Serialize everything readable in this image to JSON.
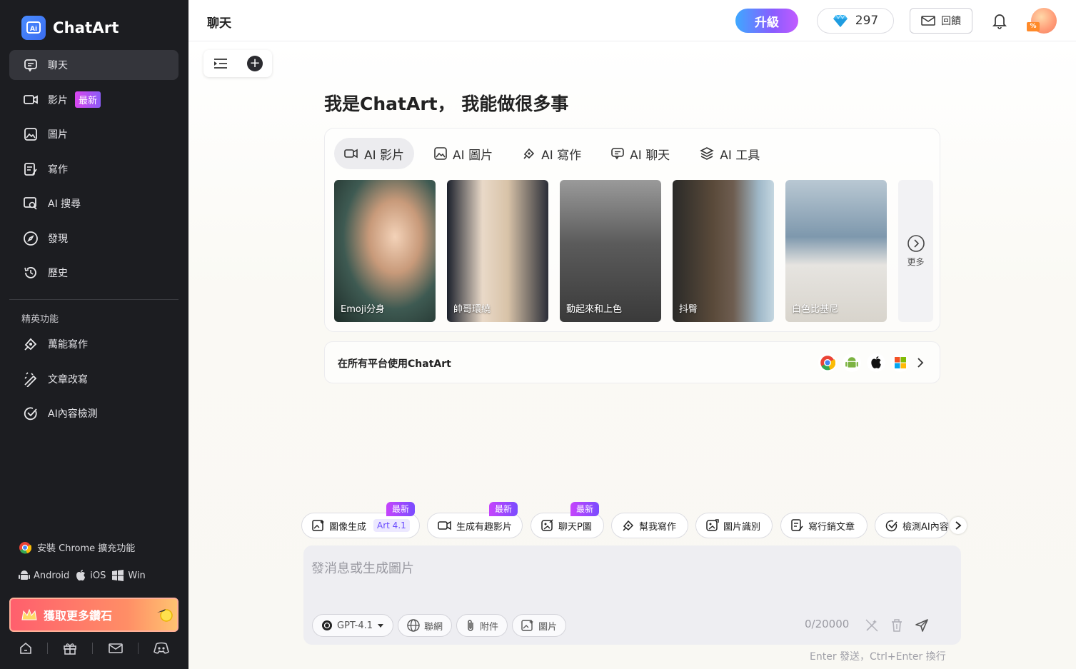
{
  "app": {
    "name": "ChatArt"
  },
  "sidebar": {
    "nav": [
      {
        "label": "聊天",
        "icon": "chat-icon",
        "active": true
      },
      {
        "label": "影片",
        "icon": "video-icon",
        "badge": "最新"
      },
      {
        "label": "圖片",
        "icon": "image-icon"
      },
      {
        "label": "寫作",
        "icon": "writing-icon"
      },
      {
        "label": "AI 搜尋",
        "icon": "ai-search-icon"
      },
      {
        "label": "發現",
        "icon": "compass-icon"
      },
      {
        "label": "歷史",
        "icon": "history-icon"
      }
    ],
    "section_title": "精英功能",
    "elite": [
      {
        "label": "萬能寫作",
        "icon": "pen-icon"
      },
      {
        "label": "文章改寫",
        "icon": "rewrite-icon"
      },
      {
        "label": "AI內容檢測",
        "icon": "check-circle-icon"
      }
    ],
    "chrome_ext": "安裝 Chrome 擴充功能",
    "platforms": {
      "android": "Android",
      "ios": "iOS",
      "win": "Win"
    },
    "cta": "獲取更多鑽石"
  },
  "header": {
    "title": "聊天",
    "upgrade": "升級",
    "gems": "297",
    "feedback": "回饋",
    "avatar_badge": "%"
  },
  "main": {
    "hero": "我是ChatArt， 我能做很多事",
    "tabs": [
      {
        "label": "AI 影片",
        "icon": "video-icon",
        "active": true
      },
      {
        "label": "AI 圖片",
        "icon": "image-icon"
      },
      {
        "label": "AI 寫作",
        "icon": "pen-icon"
      },
      {
        "label": "AI 聊天",
        "icon": "chat-icon"
      },
      {
        "label": "AI 工具",
        "icon": "layers-icon"
      }
    ],
    "thumbnails": [
      {
        "label": "Emoji分身"
      },
      {
        "label": "帥哥環繞"
      },
      {
        "label": "動起來和上色"
      },
      {
        "label": "抖臀"
      },
      {
        "label": "白色比基尼"
      }
    ],
    "more": "更多",
    "platform_banner": "在所有平台使用ChatArt",
    "chips": [
      {
        "label": "圖像生成",
        "tag": "Art 4.1",
        "new": "最新"
      },
      {
        "label": "生成有趣影片",
        "new": "最新"
      },
      {
        "label": "聊天P圖",
        "new": "最新"
      },
      {
        "label": "幫我寫作"
      },
      {
        "label": "圖片識別"
      },
      {
        "label": "寫行銷文章"
      },
      {
        "label": "檢測AI內容"
      }
    ],
    "composer": {
      "placeholder": "發消息或生成圖片",
      "model": "GPT-4.1",
      "web": "聯網",
      "attach": "附件",
      "image": "圖片",
      "counter": "0/20000",
      "hint": "Enter 發送，Ctrl+Enter 換行"
    }
  }
}
